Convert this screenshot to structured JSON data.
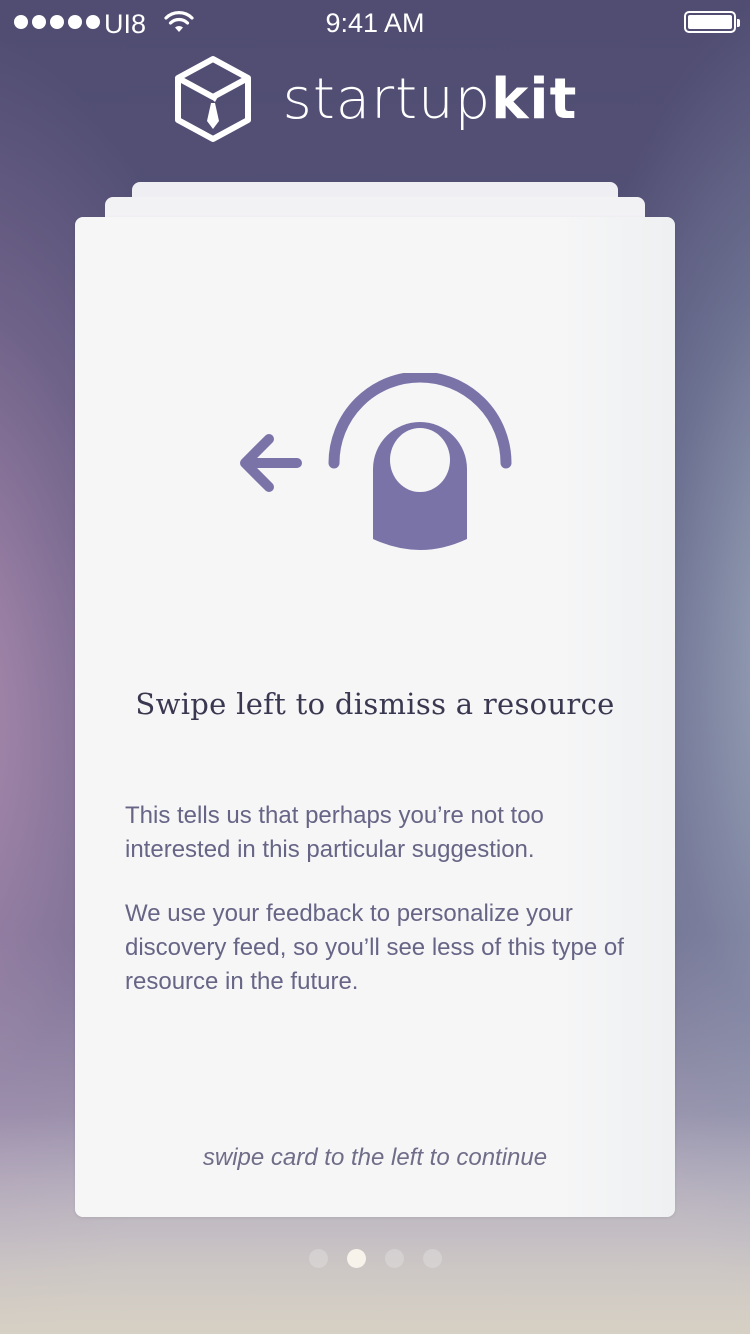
{
  "status_bar": {
    "carrier": "UI8",
    "time": "9:41 AM"
  },
  "logo": {
    "text_light": "startup",
    "text_bold": "kit",
    "icon": "tie-box-icon"
  },
  "card": {
    "icon": "swipe-left-gesture-icon",
    "title": "Swipe left to dismiss a resource",
    "paragraphs": [
      "This tells us that perhaps you’re not too interested in this particular suggestion.",
      "We use your feedback to personalize your discovery feed, so you’ll see less of this type of resource in the future."
    ],
    "hint": "swipe card to the left to continue"
  },
  "pager": {
    "total": 4,
    "active_index": 1
  },
  "colors": {
    "accent": "#7a73a8",
    "background": "#565276",
    "card": "#f6f6f7"
  }
}
